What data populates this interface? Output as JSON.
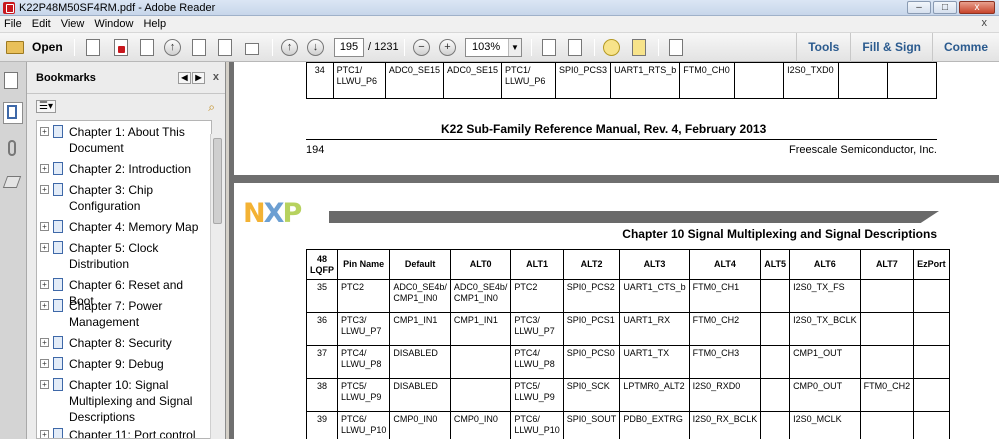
{
  "window": {
    "title": "K22P48M50SF4RM.pdf - Adobe Reader",
    "minimize": "–",
    "maximize": "□",
    "close": "x"
  },
  "menu": {
    "items": [
      "File",
      "Edit",
      "View",
      "Window",
      "Help"
    ],
    "close": "x"
  },
  "toolbar": {
    "open_label": "Open",
    "page_current": "195",
    "page_total": "/ 1231",
    "zoom": "103%",
    "zoom_out": "−",
    "zoom_in": "+",
    "prev_page": "↑",
    "next_page": "↓",
    "right_links": [
      "Tools",
      "Fill & Sign",
      "Comme"
    ]
  },
  "bookmarks": {
    "title": "Bookmarks",
    "options": "☰▾",
    "nav_prev": "◀",
    "nav_next": "▶",
    "close": "x",
    "expand_glyph": "+",
    "items": [
      "Chapter 1: About This Document",
      "Chapter 2: Introduction",
      "Chapter 3: Chip Configuration",
      "Chapter 4: Memory Map",
      "Chapter 5: Clock Distribution",
      "Chapter 6: Reset and Boot",
      "Chapter 7: Power Management",
      "Chapter 8: Security",
      "Chapter 9: Debug",
      "Chapter 10: Signal Multiplexing and Signal Descriptions",
      "Chapter 11: Port control"
    ]
  },
  "page_top": {
    "row": [
      "34",
      "PTC1/\nLLWU_P6",
      "ADC0_SE15",
      "ADC0_SE15",
      "PTC1/\nLLWU_P6",
      "SPI0_PCS3",
      "UART1_RTS_b",
      "FTM0_CH0",
      "",
      "I2S0_TXD0",
      "",
      ""
    ],
    "footer_title": "K22 Sub-Family Reference Manual, Rev. 4, February 2013",
    "page_number": "194",
    "company": "Freescale Semiconductor, Inc."
  },
  "page_bottom": {
    "logo": [
      "N",
      "X",
      "P"
    ],
    "chapter_heading": "Chapter 10 Signal Multiplexing and Signal Descriptions",
    "headers": [
      "48\nLQFP",
      "Pin Name",
      "Default",
      "ALT0",
      "ALT1",
      "ALT2",
      "ALT3",
      "ALT4",
      "ALT5",
      "ALT6",
      "ALT7",
      "EzPort"
    ],
    "rows": [
      [
        "35",
        "PTC2",
        "ADC0_SE4b/\nCMP1_IN0",
        "ADC0_SE4b/\nCMP1_IN0",
        "PTC2",
        "SPI0_PCS2",
        "UART1_CTS_b",
        "FTM0_CH1",
        "",
        "I2S0_TX_FS",
        "",
        ""
      ],
      [
        "36",
        "PTC3/\nLLWU_P7",
        "CMP1_IN1",
        "CMP1_IN1",
        "PTC3/\nLLWU_P7",
        "SPI0_PCS1",
        "UART1_RX",
        "FTM0_CH2",
        "",
        "I2S0_TX_BCLK",
        "",
        ""
      ],
      [
        "37",
        "PTC4/\nLLWU_P8",
        "DISABLED",
        "",
        "PTC4/\nLLWU_P8",
        "SPI0_PCS0",
        "UART1_TX",
        "FTM0_CH3",
        "",
        "CMP1_OUT",
        "",
        ""
      ],
      [
        "38",
        "PTC5/\nLLWU_P9",
        "DISABLED",
        "",
        "PTC5/\nLLWU_P9",
        "SPI0_SCK",
        "LPTMR0_ALT2",
        "I2S0_RXD0",
        "",
        "CMP0_OUT",
        "FTM0_CH2",
        ""
      ],
      [
        "39",
        "PTC6/\nLLWU_P10",
        "CMP0_IN0",
        "CMP0_IN0",
        "PTC6/\nLLWU_P10",
        "SPI0_SOUT",
        "PDB0_EXTRG",
        "I2S0_RX_BCLK",
        "",
        "I2S0_MCLK",
        "",
        ""
      ]
    ]
  }
}
